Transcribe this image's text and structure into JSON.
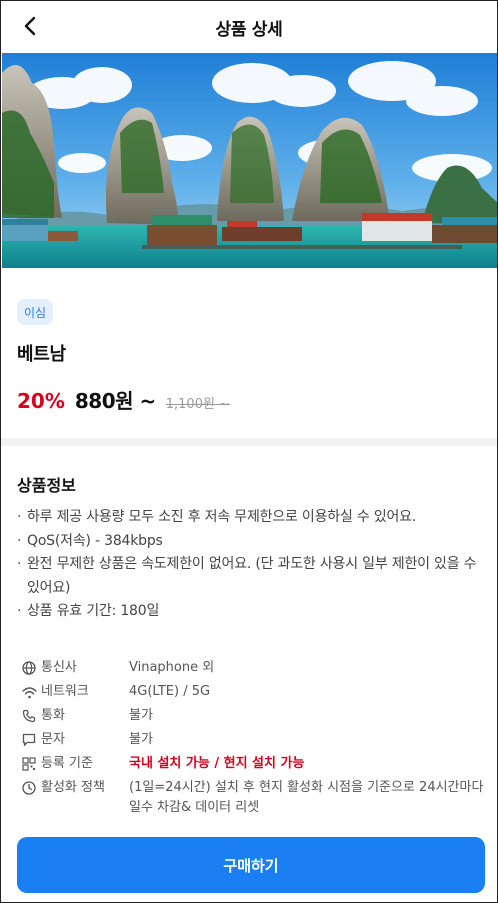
{
  "header": {
    "title": "상품 상세"
  },
  "product": {
    "badge": "이심",
    "country": "베트남",
    "discount": "20%",
    "price": "880원 ~",
    "original_price": "1,100원 ~"
  },
  "info": {
    "title": "상품정보",
    "bullets": [
      "하루 제공 사용량 모두 소진 후 저속 무제한으로 이용하실 수 있어요.",
      "QoS(저속) - 384kbps",
      "완전 무제한 상품은 속도제한이 없어요. (단 과도한 사용시 일부 제한이 있을 수 있어요)",
      "상품 유효 기간: 180일"
    ]
  },
  "specs": [
    {
      "icon": "globe-icon",
      "label": "통신사",
      "value": "Vinaphone 외"
    },
    {
      "icon": "wifi-icon",
      "label": "네트워크",
      "value": "4G(LTE) / 5G"
    },
    {
      "icon": "phone-icon",
      "label": "통화",
      "value": "불가"
    },
    {
      "icon": "message-icon",
      "label": "문자",
      "value": "불가"
    },
    {
      "icon": "qr-icon",
      "label": "등록 기준",
      "value": "국내 설치 가능 / 현지 설치 가능",
      "highlight": true
    },
    {
      "icon": "clock-icon",
      "label": "활성화 정책",
      "value": "(1일=24시간) 설치 후 현지 활성화 시점을 기준으로 24시간마다 일수 차감& 데이터 리셋"
    }
  ],
  "buy_button": {
    "label": "구매하기"
  },
  "colors": {
    "accent": "#1a7ff2",
    "discount": "#d8001e",
    "badge_bg": "#e4f0ff",
    "badge_text": "#2a7be0"
  }
}
